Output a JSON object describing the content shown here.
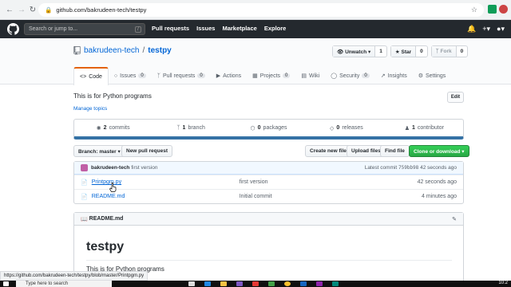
{
  "browser": {
    "url": "github.com/bakrudeen-tech/testpy"
  },
  "header": {
    "search_placeholder": "Search or jump to...",
    "search_key": "/",
    "nav": [
      "Pull requests",
      "Issues",
      "Marketplace",
      "Explore"
    ]
  },
  "repo": {
    "owner": "bakrudeen-tech",
    "separator": "/",
    "name": "testpy",
    "unwatch_label": "Unwatch",
    "unwatch_count": "1",
    "star_label": "Star",
    "star_count": "0",
    "fork_label": "Fork",
    "fork_count": "0",
    "tabs": [
      {
        "label": "Code",
        "count": ""
      },
      {
        "label": "Issues",
        "count": "0"
      },
      {
        "label": "Pull requests",
        "count": "0"
      },
      {
        "label": "Actions",
        "count": ""
      },
      {
        "label": "Projects",
        "count": "0"
      },
      {
        "label": "Wiki",
        "count": ""
      },
      {
        "label": "Security",
        "count": "0"
      },
      {
        "label": "Insights",
        "count": ""
      },
      {
        "label": "Settings",
        "count": ""
      }
    ],
    "description": "This is for Python programs",
    "manage_topics": "Manage topics",
    "edit_label": "Edit"
  },
  "summary": {
    "commits_count": "2",
    "commits_label": "commits",
    "branch_count": "1",
    "branch_label": "branch",
    "packages_count": "0",
    "packages_label": "packages",
    "releases_count": "0",
    "releases_label": "releases",
    "contributor_count": "1",
    "contributor_label": "contributor",
    "language_color": "#3572a5"
  },
  "toolbar": {
    "branch_label": "Branch: master",
    "new_pr": "New pull request",
    "create_file": "Create new file",
    "upload": "Upload files",
    "find": "Find file",
    "clone": "Clone or download"
  },
  "commit": {
    "author": "bakrudeen-tech",
    "message": "first version",
    "latest_label": "Latest commit",
    "sha": "759bb98",
    "age": "42 seconds ago"
  },
  "files": [
    {
      "name": "Printpgm.py",
      "message": "first version",
      "age": "42 seconds ago"
    },
    {
      "name": "README.md",
      "message": "Initial commit",
      "age": "4 minutes ago"
    }
  ],
  "readme": {
    "file": "README.md",
    "heading": "testpy",
    "text": "This is for Python programs"
  },
  "status_url": "https://github.com/bakrudeen-tech/testpy/blob/master/Printpgm.py",
  "taskbar": {
    "search_text": "Type here to search",
    "time": "10:2"
  }
}
